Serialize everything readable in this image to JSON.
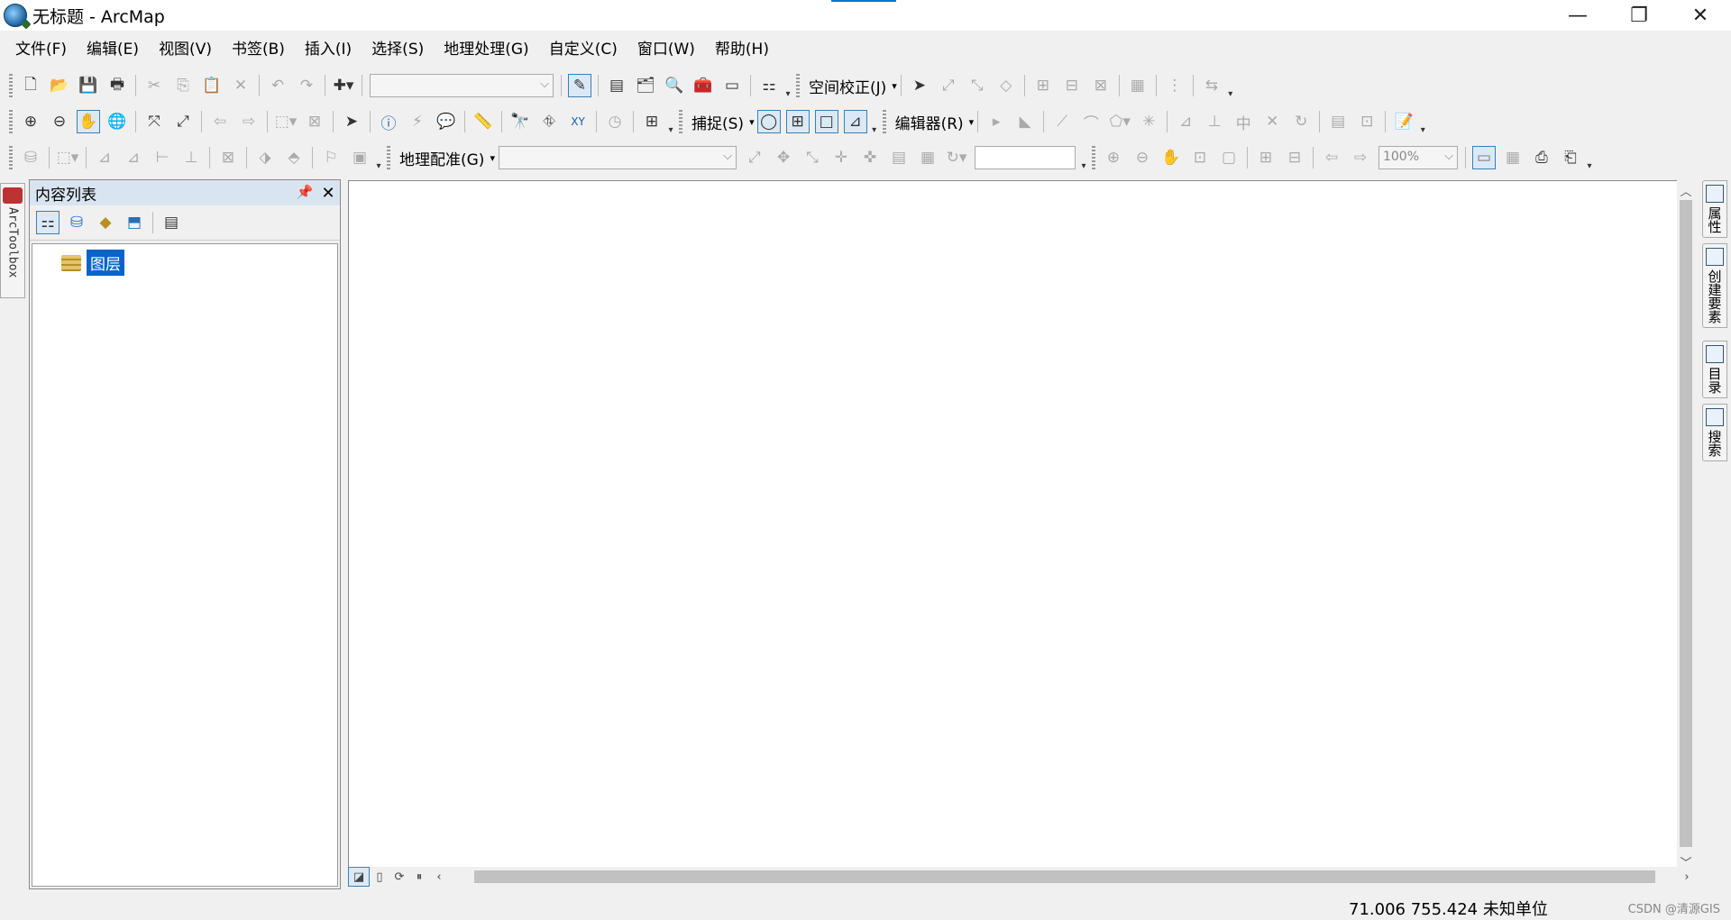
{
  "window": {
    "title": "无标题 - ArcMap",
    "minimize": "—",
    "restore": "❐",
    "close": "✕"
  },
  "menu": [
    "文件(F)",
    "编辑(E)",
    "视图(V)",
    "书签(B)",
    "插入(I)",
    "选择(S)",
    "地理处理(G)",
    "自定义(C)",
    "窗口(W)",
    "帮助(H)"
  ],
  "toolbars": {
    "spatial_adjustment": "空间校正(J)",
    "snapping": "捕捉(S)",
    "editor": "编辑器(R)",
    "georeferencing": "地理配准(G)",
    "zoom_value": "100%"
  },
  "toc": {
    "title": "内容列表",
    "pin": "📌",
    "close": "✕",
    "layer_label": "图层"
  },
  "left_dock": {
    "label": "ArcToolbox"
  },
  "right_dock": {
    "tabs": [
      "属性",
      "创建要素",
      "目录",
      "搜索"
    ]
  },
  "status": {
    "coords": "71.006  755.424 未知单位",
    "watermark": "CSDN @清源GIS"
  },
  "colors": {
    "selection": "#0a64c8",
    "accent": "#0078d7"
  }
}
